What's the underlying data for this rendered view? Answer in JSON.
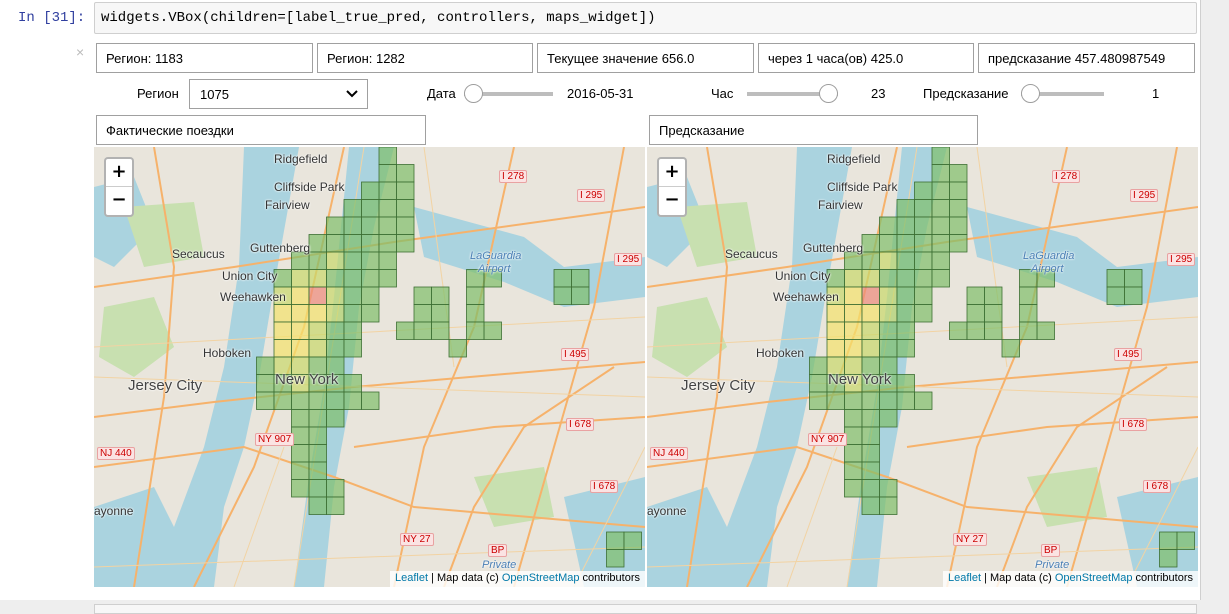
{
  "cell": {
    "prompt": "In [31]:",
    "code": "widgets.VBox(children=[label_true_pred, controllers, maps_widget])",
    "close_glyph": "×"
  },
  "info_boxes": [
    "Регион: 1183",
    "Регион: 1282",
    "Текущее значение 656.0",
    "через 1 часа(ов) 425.0",
    "предсказание 457.480987549"
  ],
  "controls": {
    "region_label": "Регион",
    "region_value": "1075",
    "date_label": "Дата",
    "date_value": "2016-05-31",
    "date_position": 0.0,
    "hour_label": "Час",
    "hour_value": "23",
    "hour_position": 1.0,
    "prediction_label": "Предсказание",
    "prediction_value": "1",
    "prediction_position": 0.0
  },
  "maps": [
    {
      "title": "Фактические поездки"
    },
    {
      "title": "Предсказание"
    }
  ],
  "map_common": {
    "zoom_in": "+",
    "zoom_out": "−",
    "attribution_leaflet": "Leaflet",
    "attribution_sep": " | Map data (c) ",
    "attribution_osm": "OpenStreetMap",
    "attribution_tail": " contributors",
    "places": {
      "ridgefield": "Ridgefield",
      "cliffside": "Cliffside Park",
      "fairview": "Fairview",
      "guttenberg": "Guttenberg",
      "secaucus": "Secaucus",
      "union_city": "Union City",
      "weehawken": "Weehawken",
      "hoboken": "Hoboken",
      "jersey_city": "Jersey City",
      "new_york": "New York",
      "laguardia": "LaGuardia",
      "airport": "Airport",
      "bayonne": "ayonne",
      "private": "Private"
    },
    "shields": {
      "i278": "I 278",
      "i295_a": "I 295",
      "i295_b": "I 295",
      "i495": "I 495",
      "i678_a": "I 678",
      "i678_b": "I 678",
      "nj440": "NJ 440",
      "ny907": "NY 907",
      "ny27": "NY 27",
      "bp": "BP"
    }
  },
  "colors": {
    "low": "#7fbf6a",
    "mid": "#c8d86a",
    "high": "#f4e36b",
    "peak": "#ee8a7a",
    "water": "#aad3df",
    "land": "#e9e5dc",
    "park": "#c8e0b0",
    "road": "#f6b26b"
  }
}
